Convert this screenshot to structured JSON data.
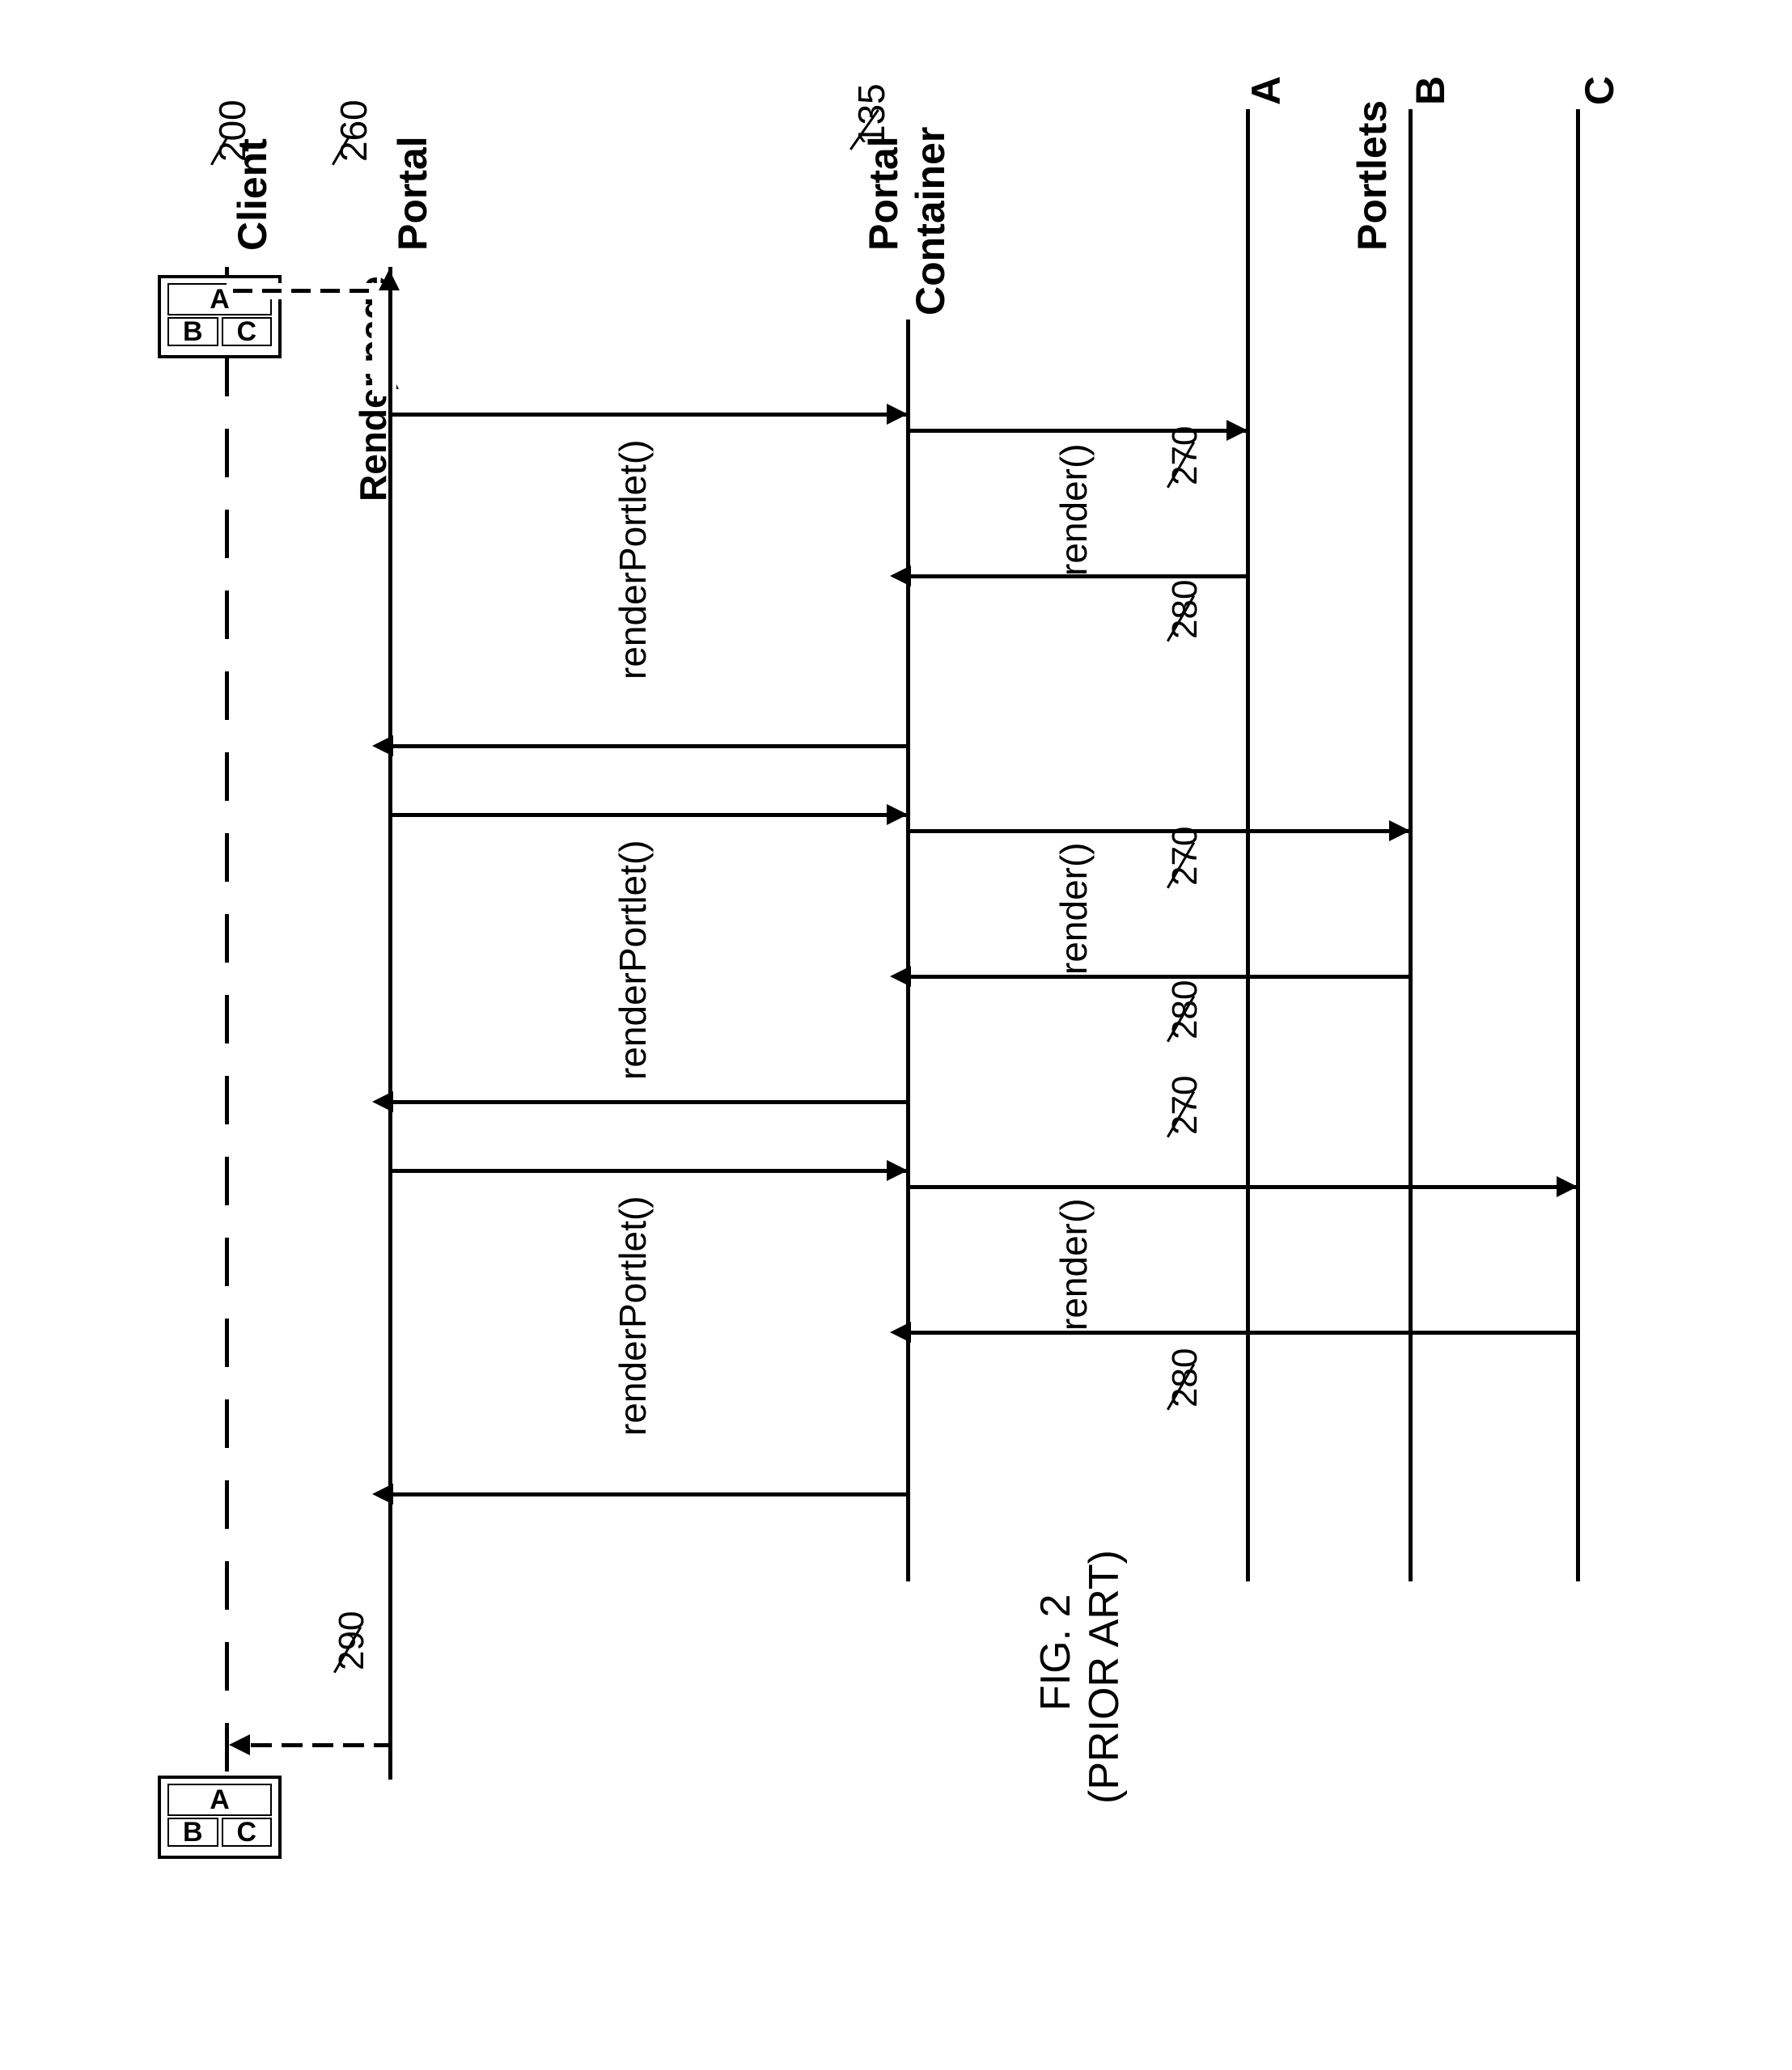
{
  "labels": {
    "client": "Client",
    "portal": "Portal",
    "portal_container_l1": "Portal",
    "portal_container_l2": "Container",
    "portlets": "Portlets",
    "A": "A",
    "B": "B",
    "C": "C",
    "render_page": "Render page",
    "renderPortlet": "renderPortlet()",
    "render": "render()",
    "fig": "FIG. 2",
    "prior_art": "(PRIOR ART)"
  },
  "refs": {
    "r200": "200",
    "r260": "260",
    "r135": "135",
    "r270": "270",
    "r280": "280",
    "r290": "290"
  },
  "portlet_cells": {
    "A": "A",
    "B": "B",
    "C": "C"
  },
  "chart_data": {
    "type": "sequence_diagram",
    "title": "FIG. 2 (PRIOR ART)",
    "lifelines": [
      "Client",
      "Portal",
      "Portal Container",
      "Portlet A",
      "Portlet B",
      "Portlet C"
    ],
    "messages": [
      {
        "from": "Client",
        "to": "Portal",
        "label": "Render page",
        "dashed": true,
        "ref": "260"
      },
      {
        "from": "Portal",
        "to": "Portal Container",
        "label": "renderPortlet()"
      },
      {
        "from": "Portal Container",
        "to": "Portlet A",
        "label": "render()",
        "ref": "270"
      },
      {
        "from": "Portlet A",
        "to": "Portal Container",
        "label": "",
        "ref": "280"
      },
      {
        "from": "Portal Container",
        "to": "Portal",
        "label": ""
      },
      {
        "from": "Portal",
        "to": "Portal Container",
        "label": "renderPortlet()"
      },
      {
        "from": "Portal Container",
        "to": "Portlet B",
        "label": "render()",
        "ref": "270"
      },
      {
        "from": "Portlet B",
        "to": "Portal Container",
        "label": "",
        "ref": "280"
      },
      {
        "from": "Portal Container",
        "to": "Portal",
        "label": ""
      },
      {
        "from": "Portal",
        "to": "Portal Container",
        "label": "renderPortlet()"
      },
      {
        "from": "Portal Container",
        "to": "Portlet C",
        "label": "render()",
        "ref": "270"
      },
      {
        "from": "Portlet C",
        "to": "Portal Container",
        "label": "",
        "ref": "280"
      },
      {
        "from": "Portal Container",
        "to": "Portal",
        "label": ""
      },
      {
        "from": "Portal",
        "to": "Client",
        "label": "",
        "dashed": true,
        "ref": "290"
      }
    ],
    "annotations": {
      "Client": "200",
      "Portal Container": "135"
    }
  }
}
